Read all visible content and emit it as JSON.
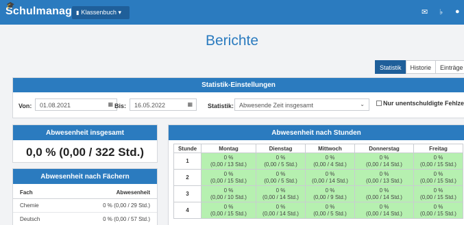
{
  "app": {
    "brand": "Schulmanager",
    "menu_label": "Klassenbuch"
  },
  "page": {
    "title": "Berichte"
  },
  "tabs": [
    "Statistik",
    "Historie",
    "Einträge"
  ],
  "settings": {
    "title": "Statistik-Einstellungen",
    "from_label": "Von:",
    "from_value": "01.08.2021",
    "to_label": "Bis:",
    "to_value": "16.05.2022",
    "stat_label": "Statistik:",
    "stat_value": "Abwesende Zeit insgesamt",
    "unexcused_label": "Nur unentschuldigte Fehlzeiten"
  },
  "total": {
    "title": "Abwesenheit insgesamt",
    "value": "0,0 % (0,00 / 322 Std.)"
  },
  "subjects": {
    "title": "Abwesenheit nach Fächern",
    "col_subject": "Fach",
    "col_absence": "Abwesenheit",
    "rows": [
      {
        "subject": "Chemie",
        "absence": "0 % (0,00 / 29 Std.)"
      },
      {
        "subject": "Deutsch",
        "absence": "0 % (0,00 / 57 Std.)"
      }
    ]
  },
  "hours": {
    "title": "Abwesenheit nach Stunden",
    "col_hour": "Stunde",
    "days": [
      "Montag",
      "Dienstag",
      "Mittwoch",
      "Donnerstag",
      "Freitag"
    ],
    "rows": [
      {
        "hour": "1",
        "cells": [
          {
            "pct": "0 %",
            "detail": "(0,00 / 13 Std.)"
          },
          {
            "pct": "0 %",
            "detail": "(0,00 / 5 Std.)"
          },
          {
            "pct": "0 %",
            "detail": "(0,00 / 4 Std.)"
          },
          {
            "pct": "0 %",
            "detail": "(0,00 / 14 Std.)"
          },
          {
            "pct": "0 %",
            "detail": "(0,00 / 15 Std.)"
          }
        ]
      },
      {
        "hour": "2",
        "cells": [
          {
            "pct": "0 %",
            "detail": "(0,00 / 15 Std.)"
          },
          {
            "pct": "0 %",
            "detail": "(0,00 / 5 Std.)"
          },
          {
            "pct": "0 %",
            "detail": "(0,00 / 14 Std.)"
          },
          {
            "pct": "0 %",
            "detail": "(0,00 / 13 Std.)"
          },
          {
            "pct": "0 %",
            "detail": "(0,00 / 15 Std.)"
          }
        ]
      },
      {
        "hour": "3",
        "cells": [
          {
            "pct": "0 %",
            "detail": "(0,00 / 10 Std.)"
          },
          {
            "pct": "0 %",
            "detail": "(0,00 / 14 Std.)"
          },
          {
            "pct": "0 %",
            "detail": "(0,00 / 9 Std.)"
          },
          {
            "pct": "0 %",
            "detail": "(0,00 / 14 Std.)"
          },
          {
            "pct": "0 %",
            "detail": "(0,00 / 15 Std.)"
          }
        ]
      },
      {
        "hour": "4",
        "cells": [
          {
            "pct": "0 %",
            "detail": "(0,00 / 15 Std.)"
          },
          {
            "pct": "0 %",
            "detail": "(0,00 / 14 Std.)"
          },
          {
            "pct": "0 %",
            "detail": "(0,00 / 5 Std.)"
          },
          {
            "pct": "0 %",
            "detail": "(0,00 / 14 Std.)"
          },
          {
            "pct": "0 %",
            "detail": "(0,00 / 15 Std.)"
          }
        ]
      }
    ]
  },
  "colors": {
    "primary": "#2b7bbf",
    "primary_dark": "#1f5f9a",
    "cell_green": "#b6f0b0"
  },
  "icons": [
    "graduation-cap-icon",
    "book-icon",
    "mail-icon",
    "bell-icon",
    "user-icon",
    "calendar-icon",
    "chevron-down-icon"
  ]
}
